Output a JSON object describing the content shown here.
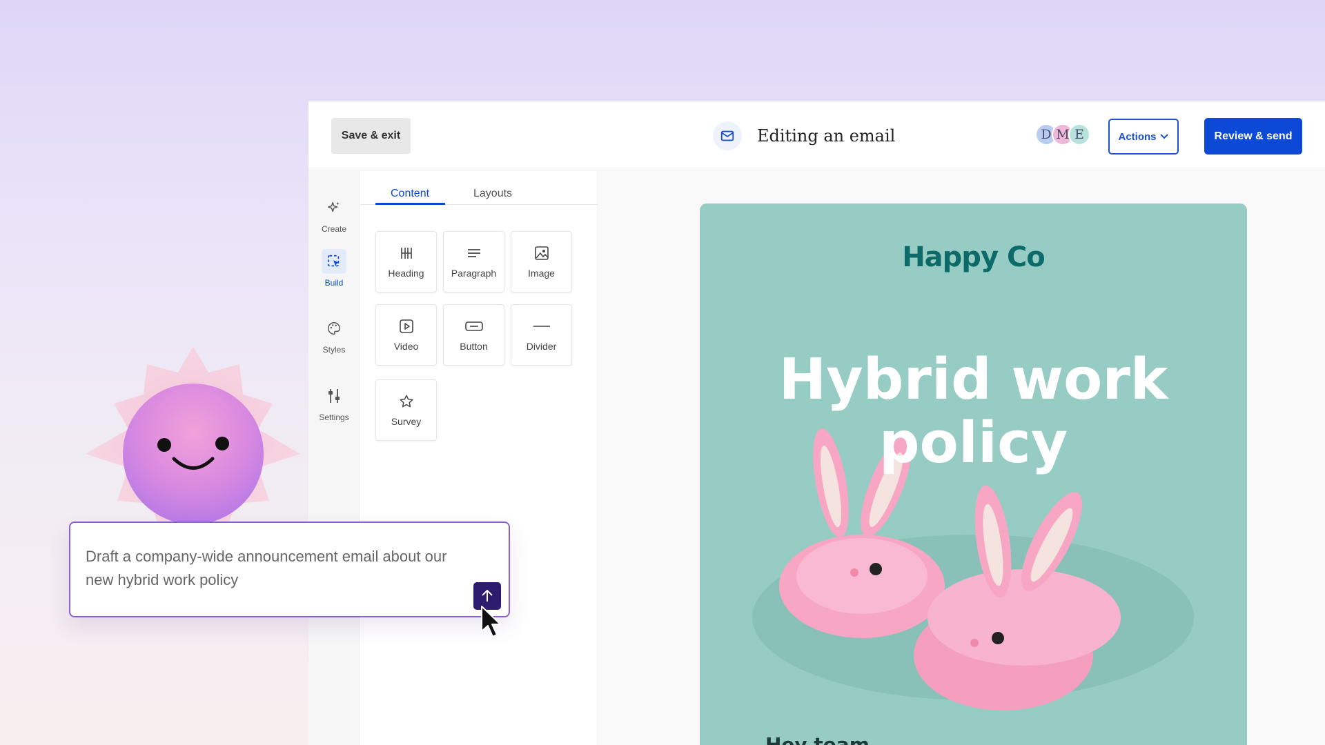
{
  "header": {
    "save_exit_label": "Save & exit",
    "title": "Editing an email",
    "title_icon": "mail-icon",
    "avatars": [
      {
        "initial": "D",
        "color": "#b9cdf3"
      },
      {
        "initial": "M",
        "color": "#efb8d8"
      },
      {
        "initial": "E",
        "color": "#b8e3dd"
      }
    ],
    "actions_label": "Actions",
    "review_label": "Review & send"
  },
  "rail": {
    "items": [
      {
        "label": "Create",
        "icon": "sparkle-icon",
        "active": false
      },
      {
        "label": "Build",
        "icon": "build-cursor-icon",
        "active": true
      },
      {
        "label": "Styles",
        "icon": "palette-icon",
        "active": false
      },
      {
        "label": "Settings",
        "icon": "sliders-icon",
        "active": false
      }
    ],
    "zoom_icon": "zoom-in-icon"
  },
  "panel": {
    "tabs": [
      {
        "label": "Content",
        "active": true
      },
      {
        "label": "Layouts",
        "active": false
      }
    ],
    "blocks": [
      {
        "label": "Heading",
        "icon": "heading-icon"
      },
      {
        "label": "Paragraph",
        "icon": "paragraph-icon"
      },
      {
        "label": "Image",
        "icon": "image-icon"
      },
      {
        "label": "Video",
        "icon": "video-icon"
      },
      {
        "label": "Button",
        "icon": "button-icon"
      },
      {
        "label": "Divider",
        "icon": "divider-icon"
      },
      {
        "label": "Survey",
        "icon": "star-icon"
      }
    ]
  },
  "email": {
    "brand": "Happy Co",
    "headline_line1": "Hybrid work",
    "headline_line2": "policy",
    "greeting": "Hey team",
    "background": "#96ccc3",
    "image": "pink-bunny-slippers"
  },
  "assistant": {
    "mascot": "smiling-sun-mascot",
    "prompt": "Draft a company-wide announcement email about our new hybrid work policy",
    "send_icon": "arrow-up-icon"
  },
  "colors": {
    "accent": "#0b49d6",
    "prompt_border": "#8b5fd9",
    "send_button": "#2d1b6e"
  }
}
